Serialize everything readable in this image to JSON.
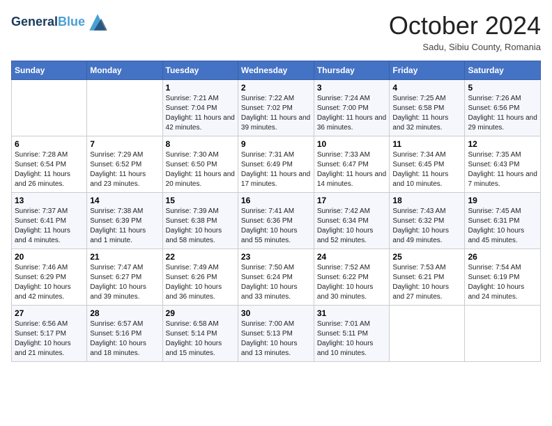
{
  "header": {
    "logo_line1": "General",
    "logo_line2": "Blue",
    "month_title": "October 2024",
    "location": "Sadu, Sibiu County, Romania"
  },
  "weekdays": [
    "Sunday",
    "Monday",
    "Tuesday",
    "Wednesday",
    "Thursday",
    "Friday",
    "Saturday"
  ],
  "weeks": [
    [
      {
        "day": "",
        "sunrise": "",
        "sunset": "",
        "daylight": ""
      },
      {
        "day": "",
        "sunrise": "",
        "sunset": "",
        "daylight": ""
      },
      {
        "day": "1",
        "sunrise": "Sunrise: 7:21 AM",
        "sunset": "Sunset: 7:04 PM",
        "daylight": "Daylight: 11 hours and 42 minutes."
      },
      {
        "day": "2",
        "sunrise": "Sunrise: 7:22 AM",
        "sunset": "Sunset: 7:02 PM",
        "daylight": "Daylight: 11 hours and 39 minutes."
      },
      {
        "day": "3",
        "sunrise": "Sunrise: 7:24 AM",
        "sunset": "Sunset: 7:00 PM",
        "daylight": "Daylight: 11 hours and 36 minutes."
      },
      {
        "day": "4",
        "sunrise": "Sunrise: 7:25 AM",
        "sunset": "Sunset: 6:58 PM",
        "daylight": "Daylight: 11 hours and 32 minutes."
      },
      {
        "day": "5",
        "sunrise": "Sunrise: 7:26 AM",
        "sunset": "Sunset: 6:56 PM",
        "daylight": "Daylight: 11 hours and 29 minutes."
      }
    ],
    [
      {
        "day": "6",
        "sunrise": "Sunrise: 7:28 AM",
        "sunset": "Sunset: 6:54 PM",
        "daylight": "Daylight: 11 hours and 26 minutes."
      },
      {
        "day": "7",
        "sunrise": "Sunrise: 7:29 AM",
        "sunset": "Sunset: 6:52 PM",
        "daylight": "Daylight: 11 hours and 23 minutes."
      },
      {
        "day": "8",
        "sunrise": "Sunrise: 7:30 AM",
        "sunset": "Sunset: 6:50 PM",
        "daylight": "Daylight: 11 hours and 20 minutes."
      },
      {
        "day": "9",
        "sunrise": "Sunrise: 7:31 AM",
        "sunset": "Sunset: 6:49 PM",
        "daylight": "Daylight: 11 hours and 17 minutes."
      },
      {
        "day": "10",
        "sunrise": "Sunrise: 7:33 AM",
        "sunset": "Sunset: 6:47 PM",
        "daylight": "Daylight: 11 hours and 14 minutes."
      },
      {
        "day": "11",
        "sunrise": "Sunrise: 7:34 AM",
        "sunset": "Sunset: 6:45 PM",
        "daylight": "Daylight: 11 hours and 10 minutes."
      },
      {
        "day": "12",
        "sunrise": "Sunrise: 7:35 AM",
        "sunset": "Sunset: 6:43 PM",
        "daylight": "Daylight: 11 hours and 7 minutes."
      }
    ],
    [
      {
        "day": "13",
        "sunrise": "Sunrise: 7:37 AM",
        "sunset": "Sunset: 6:41 PM",
        "daylight": "Daylight: 11 hours and 4 minutes."
      },
      {
        "day": "14",
        "sunrise": "Sunrise: 7:38 AM",
        "sunset": "Sunset: 6:39 PM",
        "daylight": "Daylight: 11 hours and 1 minute."
      },
      {
        "day": "15",
        "sunrise": "Sunrise: 7:39 AM",
        "sunset": "Sunset: 6:38 PM",
        "daylight": "Daylight: 10 hours and 58 minutes."
      },
      {
        "day": "16",
        "sunrise": "Sunrise: 7:41 AM",
        "sunset": "Sunset: 6:36 PM",
        "daylight": "Daylight: 10 hours and 55 minutes."
      },
      {
        "day": "17",
        "sunrise": "Sunrise: 7:42 AM",
        "sunset": "Sunset: 6:34 PM",
        "daylight": "Daylight: 10 hours and 52 minutes."
      },
      {
        "day": "18",
        "sunrise": "Sunrise: 7:43 AM",
        "sunset": "Sunset: 6:32 PM",
        "daylight": "Daylight: 10 hours and 49 minutes."
      },
      {
        "day": "19",
        "sunrise": "Sunrise: 7:45 AM",
        "sunset": "Sunset: 6:31 PM",
        "daylight": "Daylight: 10 hours and 45 minutes."
      }
    ],
    [
      {
        "day": "20",
        "sunrise": "Sunrise: 7:46 AM",
        "sunset": "Sunset: 6:29 PM",
        "daylight": "Daylight: 10 hours and 42 minutes."
      },
      {
        "day": "21",
        "sunrise": "Sunrise: 7:47 AM",
        "sunset": "Sunset: 6:27 PM",
        "daylight": "Daylight: 10 hours and 39 minutes."
      },
      {
        "day": "22",
        "sunrise": "Sunrise: 7:49 AM",
        "sunset": "Sunset: 6:26 PM",
        "daylight": "Daylight: 10 hours and 36 minutes."
      },
      {
        "day": "23",
        "sunrise": "Sunrise: 7:50 AM",
        "sunset": "Sunset: 6:24 PM",
        "daylight": "Daylight: 10 hours and 33 minutes."
      },
      {
        "day": "24",
        "sunrise": "Sunrise: 7:52 AM",
        "sunset": "Sunset: 6:22 PM",
        "daylight": "Daylight: 10 hours and 30 minutes."
      },
      {
        "day": "25",
        "sunrise": "Sunrise: 7:53 AM",
        "sunset": "Sunset: 6:21 PM",
        "daylight": "Daylight: 10 hours and 27 minutes."
      },
      {
        "day": "26",
        "sunrise": "Sunrise: 7:54 AM",
        "sunset": "Sunset: 6:19 PM",
        "daylight": "Daylight: 10 hours and 24 minutes."
      }
    ],
    [
      {
        "day": "27",
        "sunrise": "Sunrise: 6:56 AM",
        "sunset": "Sunset: 5:17 PM",
        "daylight": "Daylight: 10 hours and 21 minutes."
      },
      {
        "day": "28",
        "sunrise": "Sunrise: 6:57 AM",
        "sunset": "Sunset: 5:16 PM",
        "daylight": "Daylight: 10 hours and 18 minutes."
      },
      {
        "day": "29",
        "sunrise": "Sunrise: 6:58 AM",
        "sunset": "Sunset: 5:14 PM",
        "daylight": "Daylight: 10 hours and 15 minutes."
      },
      {
        "day": "30",
        "sunrise": "Sunrise: 7:00 AM",
        "sunset": "Sunset: 5:13 PM",
        "daylight": "Daylight: 10 hours and 13 minutes."
      },
      {
        "day": "31",
        "sunrise": "Sunrise: 7:01 AM",
        "sunset": "Sunset: 5:11 PM",
        "daylight": "Daylight: 10 hours and 10 minutes."
      },
      {
        "day": "",
        "sunrise": "",
        "sunset": "",
        "daylight": ""
      },
      {
        "day": "",
        "sunrise": "",
        "sunset": "",
        "daylight": ""
      }
    ]
  ]
}
